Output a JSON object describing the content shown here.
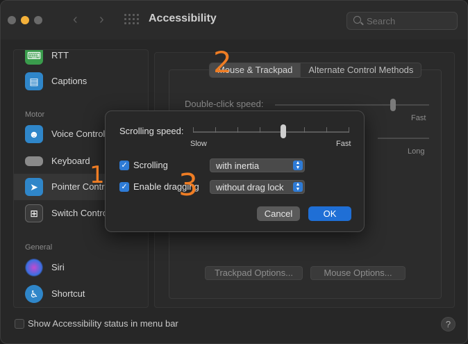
{
  "window": {
    "title": "Accessibility"
  },
  "search": {
    "placeholder": "Search"
  },
  "sidebar": {
    "items": [
      {
        "label": "RTT",
        "icon": "keyboard-icon",
        "color": "#3a9c4c"
      },
      {
        "label": "Captions",
        "icon": "captions-icon",
        "color": "#2f86c9"
      },
      {
        "label": "Voice Control",
        "icon": "voice-control-icon",
        "color": "#2f86c9"
      },
      {
        "label": "Keyboard",
        "icon": "keyboard-icon",
        "color": "#8a8a8a"
      },
      {
        "label": "Pointer Control",
        "icon": "pointer-icon",
        "color": "#2f86c9"
      },
      {
        "label": "Switch Control",
        "icon": "switch-control-icon",
        "color": "#3a3a3a"
      },
      {
        "label": "Siri",
        "icon": "siri-icon",
        "color": "#444"
      },
      {
        "label": "Shortcut",
        "icon": "shortcut-icon",
        "color": "#2f86c9"
      }
    ],
    "headers": {
      "motor": "Motor",
      "general": "General"
    }
  },
  "tabs": [
    "Mouse & Trackpad",
    "Alternate Control Methods"
  ],
  "background": {
    "double_click_label": "Double-click speed:",
    "fast_label": "Fast",
    "long_label": "Long",
    "trackpad_options": "Trackpad Options...",
    "mouse_options": "Mouse Options..."
  },
  "footer": {
    "label": "Show Accessibility status in menu bar",
    "help": "?"
  },
  "dialog": {
    "scrolling_speed_label": "Scrolling speed:",
    "scrolling_speed": 0.58,
    "slow_label": "Slow",
    "fast_label": "Fast",
    "scrolling": {
      "label": "Scrolling",
      "checked": true,
      "value": "with inertia"
    },
    "dragging": {
      "label": "Enable dragging",
      "checked": true,
      "value": "without drag lock"
    },
    "cancel_label": "Cancel",
    "ok_label": "OK"
  },
  "annotations": [
    "1",
    "2",
    "3"
  ],
  "colors": {
    "accent": "#1f6fd6",
    "annotation": "#ef7d24"
  }
}
